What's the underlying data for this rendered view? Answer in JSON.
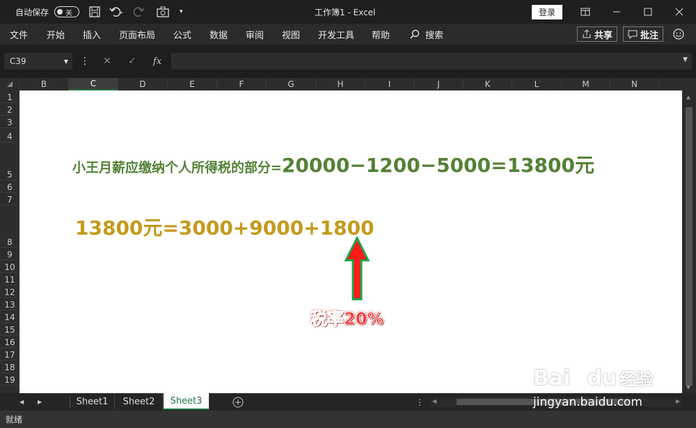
{
  "titlebar": {
    "autosave_label": "自动保存",
    "toggle_label": "关",
    "title": "工作簿1  -  Excel",
    "login": "登录"
  },
  "menu": {
    "items": [
      "文件",
      "开始",
      "插入",
      "页面布局",
      "公式",
      "数据",
      "审阅",
      "视图",
      "开发工具",
      "帮助"
    ],
    "search": "搜索",
    "share": "共享",
    "comment": "批注"
  },
  "formula_bar": {
    "name_box": "C39",
    "fx": "fx",
    "value": ""
  },
  "columns": [
    "B",
    "C",
    "D",
    "E",
    "F",
    "G",
    "H",
    "I",
    "J",
    "K",
    "L",
    "M",
    "N"
  ],
  "rows": [
    "1",
    "2",
    "3",
    "4",
    "5",
    "6",
    "7",
    "8",
    "9",
    "10",
    "11",
    "12",
    "13",
    "14",
    "15",
    "16",
    "17",
    "18",
    "19"
  ],
  "cells": {
    "line1_text": "小王月薪应缴纳个人所得税的部分=",
    "line1_formula": "20000−1200−5000=13800元",
    "line2": "13800元=3000+9000+1800",
    "annotation": "税率20%"
  },
  "sheets": [
    "Sheet1",
    "Sheet2",
    "Sheet3"
  ],
  "active_sheet": "Sheet3",
  "status": "就绪",
  "watermark": {
    "brand": "Bai",
    "brand_suffix": "du",
    "brand_cn": "经验",
    "url": "jingyan.baidu.com"
  },
  "colors": {
    "green_text": "#538135",
    "gold_text": "#c49a1c",
    "red_text": "#ff2a2a",
    "excel_green": "#217346"
  }
}
